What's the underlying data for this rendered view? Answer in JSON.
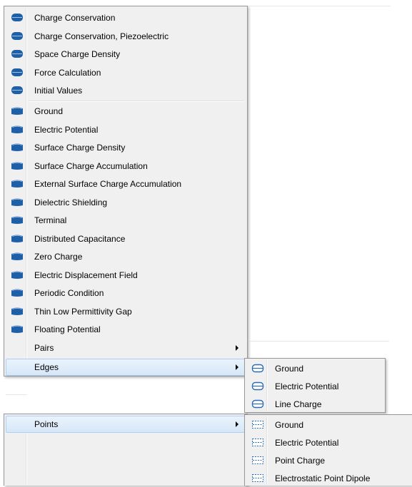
{
  "main_menu": {
    "domain_items": [
      {
        "label": "Charge Conservation",
        "icon": "domain-node-icon"
      },
      {
        "label": "Charge Conservation, Piezoelectric",
        "icon": "domain-node-icon"
      },
      {
        "label": "Space Charge Density",
        "icon": "domain-node-icon"
      },
      {
        "label": "Force Calculation",
        "icon": "domain-node-icon"
      },
      {
        "label": "Initial Values",
        "icon": "domain-node-icon"
      }
    ],
    "boundary_items": [
      {
        "label": "Ground",
        "icon": "boundary-node-icon"
      },
      {
        "label": "Electric Potential",
        "icon": "boundary-node-icon"
      },
      {
        "label": "Surface Charge Density",
        "icon": "boundary-node-icon"
      },
      {
        "label": "Surface Charge Accumulation",
        "icon": "boundary-node-icon"
      },
      {
        "label": "External Surface Charge Accumulation",
        "icon": "boundary-node-icon"
      },
      {
        "label": "Dielectric Shielding",
        "icon": "boundary-node-icon"
      },
      {
        "label": "Terminal",
        "icon": "boundary-node-icon"
      },
      {
        "label": "Distributed Capacitance",
        "icon": "boundary-node-icon"
      },
      {
        "label": "Zero Charge",
        "icon": "boundary-node-icon"
      },
      {
        "label": "Electric Displacement Field",
        "icon": "boundary-node-icon"
      },
      {
        "label": "Periodic Condition",
        "icon": "boundary-node-icon"
      },
      {
        "label": "Thin Low Permittivity Gap",
        "icon": "boundary-node-icon"
      },
      {
        "label": "Floating Potential",
        "icon": "boundary-node-icon"
      }
    ],
    "pairs_label": "Pairs",
    "edges_label": "Edges",
    "points_label": "Points"
  },
  "edges_submenu": {
    "items": [
      {
        "label": "Ground",
        "icon": "edge-node-icon"
      },
      {
        "label": "Electric Potential",
        "icon": "edge-node-icon"
      },
      {
        "label": "Line Charge",
        "icon": "edge-node-icon"
      }
    ]
  },
  "points_submenu": {
    "items": [
      {
        "label": "Ground",
        "icon": "point-node-icon"
      },
      {
        "label": "Electric Potential",
        "icon": "point-node-icon"
      },
      {
        "label": "Point Charge",
        "icon": "point-node-icon"
      },
      {
        "label": "Electrostatic Point Dipole",
        "icon": "point-node-icon"
      }
    ]
  },
  "colors": {
    "icon_blue": "#1f5fa6",
    "highlight": "#d7e7f8",
    "menu_bg": "#f0f0f0"
  }
}
